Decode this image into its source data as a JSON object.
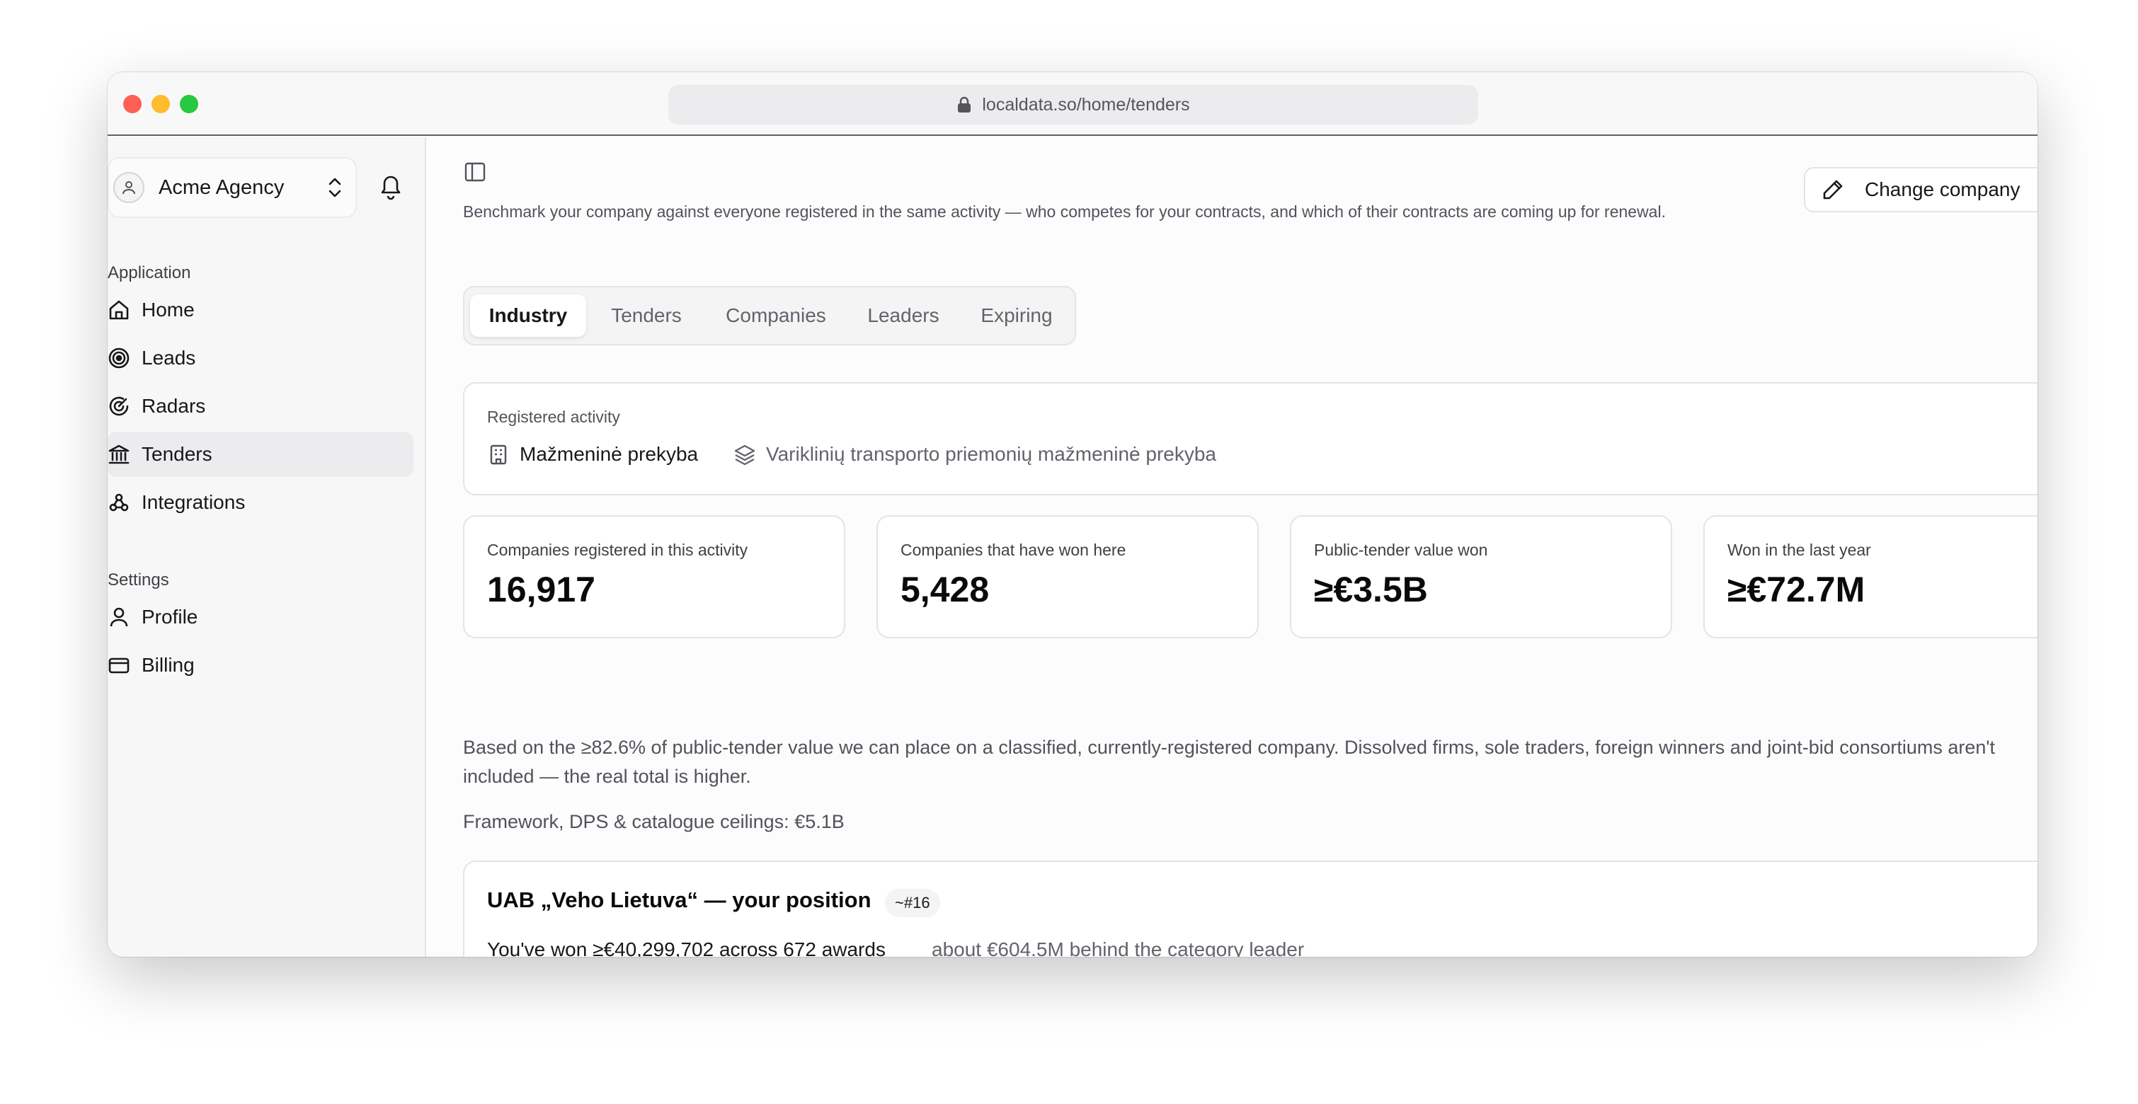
{
  "browser": {
    "url": "localdata.so/home/tenders",
    "traffic_colors": {
      "close": "#fe5f57",
      "minimize": "#febc2e",
      "zoom": "#28c840"
    }
  },
  "sidebar": {
    "company": "Acme Agency",
    "application_label": "Application",
    "application_items": [
      {
        "label": "Home",
        "icon": "home-icon"
      },
      {
        "label": "Leads",
        "icon": "target-icon"
      },
      {
        "label": "Radars",
        "icon": "radar-icon"
      },
      {
        "label": "Tenders",
        "icon": "landmark-icon",
        "active": true
      },
      {
        "label": "Integrations",
        "icon": "webhook-icon"
      }
    ],
    "settings_label": "Settings",
    "settings_items": [
      {
        "label": "Profile",
        "icon": "user-icon"
      },
      {
        "label": "Billing",
        "icon": "credit-card-icon"
      }
    ]
  },
  "header": {
    "subtitle": "Benchmark your company against everyone registered in the same activity — who competes for your contracts, and which of their contracts are coming up for renewal.",
    "change_company": "Change company"
  },
  "tabs": [
    {
      "label": "Industry",
      "active": true
    },
    {
      "label": "Tenders"
    },
    {
      "label": "Companies"
    },
    {
      "label": "Leaders"
    },
    {
      "label": "Expiring"
    }
  ],
  "activity": {
    "label": "Registered activity",
    "primary": "Mažmeninė prekyba",
    "secondary": "Variklinių transporto priemonių mažmeninė prekyba"
  },
  "stats": [
    {
      "label": "Companies registered in this activity",
      "value": "16,917"
    },
    {
      "label": "Companies that have won here",
      "value": "5,428"
    },
    {
      "label": "Public-tender value won",
      "value": "≥€3.5B"
    },
    {
      "label": "Won in the last year",
      "value": "≥€72.7M"
    }
  ],
  "note": "Based on the ≥82.6% of public-tender value we can place on a classified, currently-registered company. Dissolved firms, sole traders, foreign winners and joint-bid consortiums aren't included — the real total is higher.",
  "ceiling": "Framework, DPS & catalogue ceilings: €5.1B",
  "position": {
    "title": "UAB „Veho Lietuva“ — your position",
    "rank": "~#16",
    "won": "You've won ≥€40,299,702 across 672 awards",
    "behind": "about €604.5M behind the category leader"
  }
}
